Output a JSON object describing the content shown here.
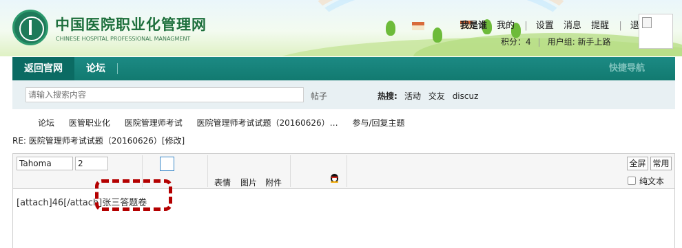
{
  "site": {
    "title": "中国医院职业化管理网",
    "subtitle": "CHINESE HOSPITAL PROFESSIONAL MANAGMENT"
  },
  "user": {
    "links": [
      "我是谁",
      "我的",
      "设置",
      "消息",
      "提醒",
      "退出"
    ],
    "points": "积分：4",
    "group": "用户组: 新手上路"
  },
  "nav": {
    "home": "返回官网",
    "forum": "论坛",
    "quick": "快捷导航"
  },
  "search": {
    "placeholder": "请输入搜索内容",
    "scope": "帖子",
    "hot_label": "热搜:",
    "hot_words": [
      "活动",
      "交友",
      "discuz"
    ]
  },
  "breadcrumb": [
    "论坛",
    "医管职业化",
    "医院管理师考试",
    "医院管理师考试试题（20160626）…",
    "参与/回复主题"
  ],
  "post": {
    "title": "RE: 医院管理师考试试题（20160626）[修改]"
  },
  "editor": {
    "font": "Tahoma",
    "size": "2",
    "emoji": "表情",
    "image": "图片",
    "attachment": "附件",
    "fullscreen": "全屏",
    "common": "常用",
    "plain_text": "纯文本",
    "content": "[attach]46[/attach]张三答题卷"
  },
  "colors": {
    "nav_bg": "#127a70",
    "nav_home_bg": "#0b6b63",
    "search_bg": "#e8f0f3",
    "title_green": "#1d6f3c",
    "annotation": "#b40000"
  }
}
